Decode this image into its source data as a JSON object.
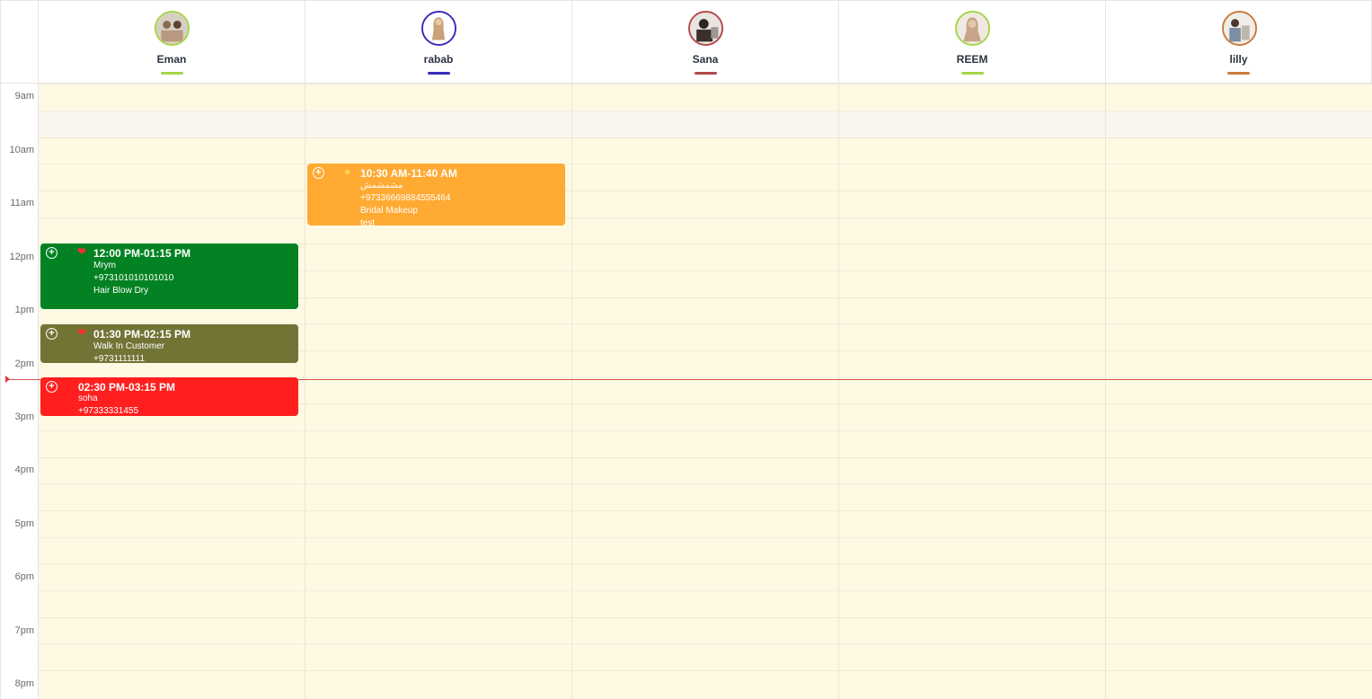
{
  "staff": [
    {
      "name": "Eman",
      "color": "#a6d44a",
      "avatar_icon": "staff-photo-icon"
    },
    {
      "name": "rabab",
      "color": "#3b2ab8",
      "avatar_icon": "staff-photo-icon"
    },
    {
      "name": "Sana",
      "color": "#b3474a",
      "avatar_icon": "staff-photo-icon"
    },
    {
      "name": "REEM",
      "color": "#a6d44a",
      "avatar_icon": "staff-photo-icon"
    },
    {
      "name": "lilly",
      "color": "#c97a3a",
      "avatar_icon": "staff-photo-icon"
    }
  ],
  "hours": [
    "9am",
    "10am",
    "11am",
    "12pm",
    "1pm",
    "2pm",
    "3pm",
    "4pm",
    "5pm",
    "6pm",
    "7pm",
    "8pm"
  ],
  "appointments": [
    {
      "time": "10:30 AM-11:40 AM",
      "icon": "comment-icon",
      "color": "#ffaa33",
      "lines": [
        "مشمشمش",
        "+97336669884555464",
        "Bridal Makeup",
        "test"
      ]
    },
    {
      "time": "12:00 PM-01:15 PM",
      "icon": "heart-icon",
      "color": "#028222",
      "lines": [
        "Mrym",
        "+973101010101010",
        "Hair Blow Dry"
      ]
    },
    {
      "time": "01:30 PM-02:15 PM",
      "icon": "heart-icon",
      "color": "#727436",
      "lines": [
        "Walk In Customer",
        "+9731111111"
      ]
    },
    {
      "time": "02:30 PM-03:15 PM",
      "icon": "",
      "color": "#ff1f1f",
      "lines": [
        "soha",
        "+97333331455"
      ]
    }
  ]
}
